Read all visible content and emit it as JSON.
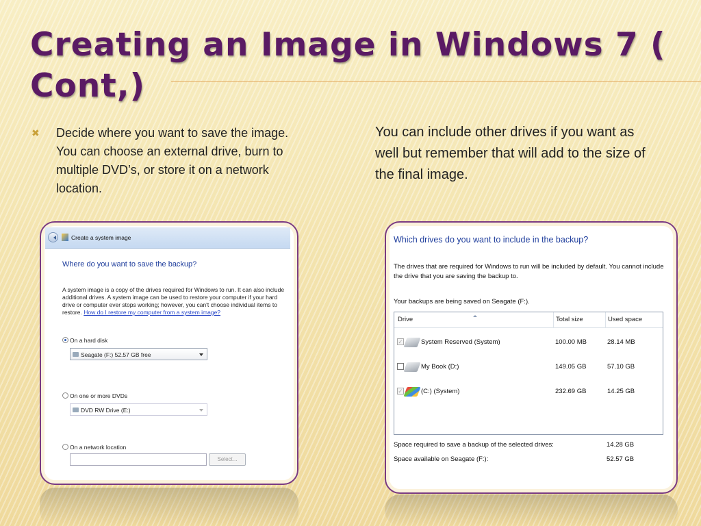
{
  "slide": {
    "title": "Creating an Image in Windows 7 ( Cont,)",
    "bullet_text": "Decide where you want to save the image. You can choose an external drive, burn to multiple DVD’s, or store it on a network location.",
    "right_text": "You can include other drives if you want as well but remember that will add to the size of the final image."
  },
  "left_dialog": {
    "window_title": "Create a system image",
    "heading": "Where do you want to save the backup?",
    "description": "A system image is a copy of the drives required for Windows to run. It can also include additional drives. A system image can be used to restore your computer if your hard drive or computer ever stops working; however, you can't choose individual items to restore.",
    "help_link": "How do I restore my computer from a system image?",
    "option_hard_disk": "On a hard disk",
    "hard_disk_value": "Seagate (F:)  52.57 GB free",
    "option_dvd": "On one or more DVDs",
    "dvd_value": "DVD RW Drive (E:)",
    "option_network": "On a network location",
    "network_value": "",
    "select_button": "Select...",
    "selected_option": "hard_disk"
  },
  "right_dialog": {
    "heading": "Which drives do you want to include in the backup?",
    "description": "The drives that are required for Windows to run will be included by default. You cannot include the drive that you are saving the backup to.",
    "saved_on": "Your backups are being saved on Seagate (F:).",
    "columns": [
      "Drive",
      "Total size",
      "Used space"
    ],
    "rows": [
      {
        "name": "System Reserved (System)",
        "total": "100.00 MB",
        "used": "28.14 MB",
        "checked": true,
        "checkbox_enabled": false
      },
      {
        "name": "My Book (D:)",
        "total": "149.05 GB",
        "used": "57.10 GB",
        "checked": false,
        "checkbox_enabled": true
      },
      {
        "name": "(C:) (System)",
        "total": "232.69 GB",
        "used": "14.25 GB",
        "checked": true,
        "checkbox_enabled": false
      }
    ],
    "required_label": "Space required to save a backup of the selected drives:",
    "required_value": "14.28 GB",
    "available_label": "Space available on Seagate (F:):",
    "available_value": "52.57 GB"
  },
  "colors": {
    "title": "#5a1a64",
    "frame": "#7a3a82",
    "link": "#1e3d9c"
  }
}
